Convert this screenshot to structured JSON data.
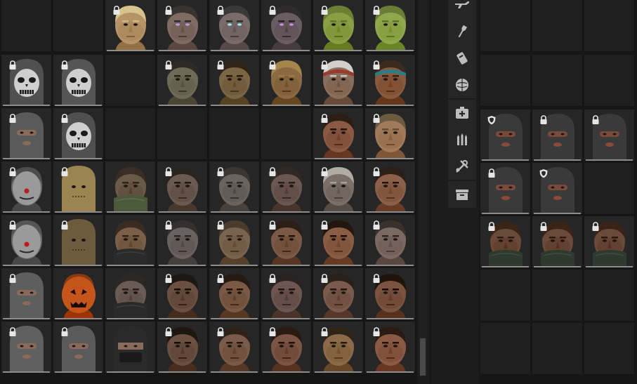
{
  "colors": {
    "panel_bg": "#161616",
    "cell_bg": "#242424",
    "accent_bar": "#8d8d8d",
    "icon": "#bdbdbd"
  },
  "category_tabs": [
    {
      "name": "weapons",
      "icon": "rifle-icon"
    },
    {
      "name": "tools",
      "icon": "flashlight-icon"
    },
    {
      "name": "explosives",
      "icon": "grenade-icon"
    },
    {
      "name": "ammo-pouch",
      "icon": "round-shield-icon"
    },
    {
      "name": "medical",
      "icon": "medkit-icon"
    },
    {
      "name": "ammo",
      "icon": "ammo-icon"
    },
    {
      "name": "crafting",
      "icon": "wrench-screwdriver-icon"
    },
    {
      "name": "storage",
      "icon": "storage-box-icon"
    }
  ],
  "left_grid": {
    "rows": [
      [
        {
          "kind": "empty"
        },
        {
          "kind": "empty"
        },
        {
          "kind": "face",
          "skin": "#b79368",
          "hair": "#d8c28d",
          "locked": true
        },
        {
          "kind": "face",
          "skin": "#7f6b62",
          "hair": "#3a3430",
          "eyes": "#b59adf",
          "locked": true
        },
        {
          "kind": "face",
          "skin": "#7a6c6a",
          "hair": "#3a3838",
          "eyes": "#9be3f2",
          "locked": true
        },
        {
          "kind": "face",
          "skin": "#6a5d62",
          "hair": "#302c2e",
          "eyes": "#c98fe6",
          "locked": true
        },
        {
          "kind": "face",
          "skin": "#8a9f44",
          "hair": "#6c7f33",
          "locked": true
        },
        {
          "kind": "face",
          "skin": "#90a84c",
          "hair": "#6a7c36",
          "locked": true
        }
      ],
      [
        {
          "kind": "face",
          "skin": "#505050",
          "hair": "#3a3a3a",
          "mask": "skull",
          "locked": true
        },
        {
          "kind": "face",
          "skin": "#555555",
          "hair": "#3b3b3b",
          "mask": "skull",
          "locked": true
        },
        {
          "kind": "empty"
        },
        {
          "kind": "face",
          "skin": "#6f6a58",
          "hair": "#2f2b24",
          "locked": true
        },
        {
          "kind": "face",
          "skin": "#7a6544",
          "hair": "#2e2418",
          "locked": true
        },
        {
          "kind": "face",
          "skin": "#8a6a42",
          "hair": "#a5854b",
          "locked": true
        },
        {
          "kind": "face",
          "skin": "#8a6e5c",
          "hair": "#d2d0c8",
          "band": "#9a3a2e",
          "locked": true
        },
        {
          "kind": "face",
          "skin": "#8a5a3e",
          "hair": "#3c2a1e",
          "band": "#2d7d86",
          "locked": true
        }
      ],
      [
        {
          "kind": "face",
          "skin": "#5a5a5a",
          "hair": "#4a4a4a",
          "mask": "balaclava",
          "locked": true
        },
        {
          "kind": "face",
          "skin": "#505050",
          "hair": "#3a3a3a",
          "mask": "skull",
          "locked": true
        },
        {
          "kind": "empty"
        },
        {
          "kind": "empty"
        },
        {
          "kind": "empty"
        },
        {
          "kind": "empty"
        },
        {
          "kind": "face",
          "skin": "#8a5a44",
          "hair": "#2c1e16",
          "locked": true
        },
        {
          "kind": "face",
          "skin": "#a07a5a",
          "hair": "#6a5a40",
          "locked": true
        }
      ],
      [
        {
          "kind": "face",
          "skin": "#6a6a6a",
          "hair": "#4d4d4d",
          "mask": "clown",
          "locked": true
        },
        {
          "kind": "face",
          "skin": "#9a8452",
          "hair": "#857043",
          "mask": "sack",
          "locked": true
        },
        {
          "kind": "face",
          "skin": "#6a5a48",
          "hair": "#3a2e24",
          "scarf": "#4a5a3a",
          "locked": false
        },
        {
          "kind": "face",
          "skin": "#6a5a50",
          "hair": "#2a2420",
          "locked": true
        },
        {
          "kind": "face",
          "skin": "#6a6460",
          "hair": "#3a3634",
          "locked": true
        },
        {
          "kind": "face",
          "skin": "#6a5850",
          "hair": "#302822",
          "locked": true
        },
        {
          "kind": "face",
          "skin": "#7a7068",
          "hair": "#b0aca4",
          "locked": true
        },
        {
          "kind": "face",
          "skin": "#8a6048",
          "hair": "#2a1e16",
          "locked": true
        }
      ],
      [
        {
          "kind": "face",
          "skin": "#6a6a6a",
          "hair": "#555555",
          "mask": "clown",
          "locked": true
        },
        {
          "kind": "face",
          "skin": "#6e5a3c",
          "hair": "#5a4830",
          "mask": "sack",
          "locked": true
        },
        {
          "kind": "face",
          "skin": "#7a6048",
          "hair": "#3a2c20",
          "scarf": "#2a2a2a",
          "locked": false
        },
        {
          "kind": "face",
          "skin": "#6a6260",
          "hair": "#343030",
          "locked": true
        },
        {
          "kind": "face",
          "skin": "#7a6450",
          "hair": "#4a3c2c",
          "locked": true
        },
        {
          "kind": "face",
          "skin": "#7a5a46",
          "hair": "#2a1e16",
          "locked": true
        },
        {
          "kind": "face",
          "skin": "#8a5e44",
          "hair": "#22160e",
          "locked": true
        },
        {
          "kind": "face",
          "skin": "#7a6a62",
          "hair": "#3a302c",
          "locked": true
        }
      ],
      [
        {
          "kind": "face",
          "skin": "#5e5e5e",
          "hair": "#4a4a4a",
          "mask": "balaclava",
          "locked": true
        },
        {
          "kind": "face",
          "skin": "#c4561c",
          "hair": "#8a3a12",
          "mask": "pumpkin",
          "locked": false
        },
        {
          "kind": "face",
          "skin": "#6a5c54",
          "hair": "#2e2824",
          "scarf": "#2a2a2a",
          "locked": false
        },
        {
          "kind": "face",
          "skin": "#6a5040",
          "hair": "#1e1610",
          "locked": true
        },
        {
          "kind": "face",
          "skin": "#7a5a46",
          "hair": "#261a12",
          "locked": true
        },
        {
          "kind": "face",
          "skin": "#6e5650",
          "hair": "#2a2220",
          "locked": true
        },
        {
          "kind": "face",
          "skin": "#7a5a4c",
          "hair": "#2a201a",
          "locked": true
        },
        {
          "kind": "face",
          "skin": "#7a5440",
          "hair": "#1e140c",
          "locked": true
        }
      ],
      [
        {
          "kind": "face",
          "skin": "#606060",
          "hair": "#4a4a4a",
          "mask": "balaclava",
          "locked": true
        },
        {
          "kind": "face",
          "skin": "#5a5a5a",
          "hair": "#444444",
          "mask": "balaclava",
          "locked": true
        },
        {
          "kind": "face",
          "skin": "#4a4a4a",
          "hair": "#2a2a2a",
          "mask": "ninja",
          "locked": false
        },
        {
          "kind": "face",
          "skin": "#6a5040",
          "hair": "#1e1610",
          "locked": true
        },
        {
          "kind": "face",
          "skin": "#7a5a48",
          "hair": "#2e2218",
          "locked": true
        },
        {
          "kind": "face",
          "skin": "#7a5444",
          "hair": "#2a1a12",
          "locked": true
        },
        {
          "kind": "face",
          "skin": "#8a6a48",
          "hair": "#2e2418",
          "locked": true
        },
        {
          "kind": "face",
          "skin": "#8a5a44",
          "hair": "#2a1c12",
          "locked": true
        }
      ]
    ]
  },
  "right_grid": {
    "rows": [
      [
        {
          "kind": "empty"
        },
        {
          "kind": "empty"
        },
        {
          "kind": "empty"
        }
      ],
      [
        {
          "kind": "empty"
        },
        {
          "kind": "empty"
        },
        {
          "kind": "empty"
        }
      ],
      [
        {
          "kind": "face",
          "skin": "#3a3a3a",
          "hair": "#2a2a2a",
          "mask": "balaclava-black",
          "badge": "shield"
        },
        {
          "kind": "face",
          "skin": "#3a3a3a",
          "hair": "#2a2a2a",
          "mask": "balaclava-black",
          "badge": "lock"
        },
        {
          "kind": "face",
          "skin": "#3a3a3a",
          "hair": "#2a2a2a",
          "mask": "balaclava-black",
          "badge": "lock"
        }
      ],
      [
        {
          "kind": "face",
          "skin": "#3a3a3a",
          "hair": "#2a2a2a",
          "mask": "balaclava-black",
          "badge": "lock"
        },
        {
          "kind": "face",
          "skin": "#3a3a3a",
          "hair": "#2a2a2a",
          "mask": "balaclava-black",
          "badge": "shield"
        },
        {
          "kind": "empty"
        }
      ],
      [
        {
          "kind": "face",
          "skin": "#6a4a3a",
          "hair": "#3a2418",
          "scarf": "#2e3a2e",
          "badge": "lock"
        },
        {
          "kind": "face",
          "skin": "#6a4a3a",
          "hair": "#3a2418",
          "scarf": "#2e3a2e",
          "badge": "lock"
        },
        {
          "kind": "face",
          "skin": "#6a4a3a",
          "hair": "#3a2418",
          "scarf": "#2e3a2e",
          "badge": "lock"
        }
      ],
      [
        {
          "kind": "empty"
        },
        {
          "kind": "empty"
        },
        {
          "kind": "empty"
        }
      ],
      [
        {
          "kind": "empty"
        },
        {
          "kind": "empty"
        },
        {
          "kind": "empty"
        }
      ]
    ]
  }
}
